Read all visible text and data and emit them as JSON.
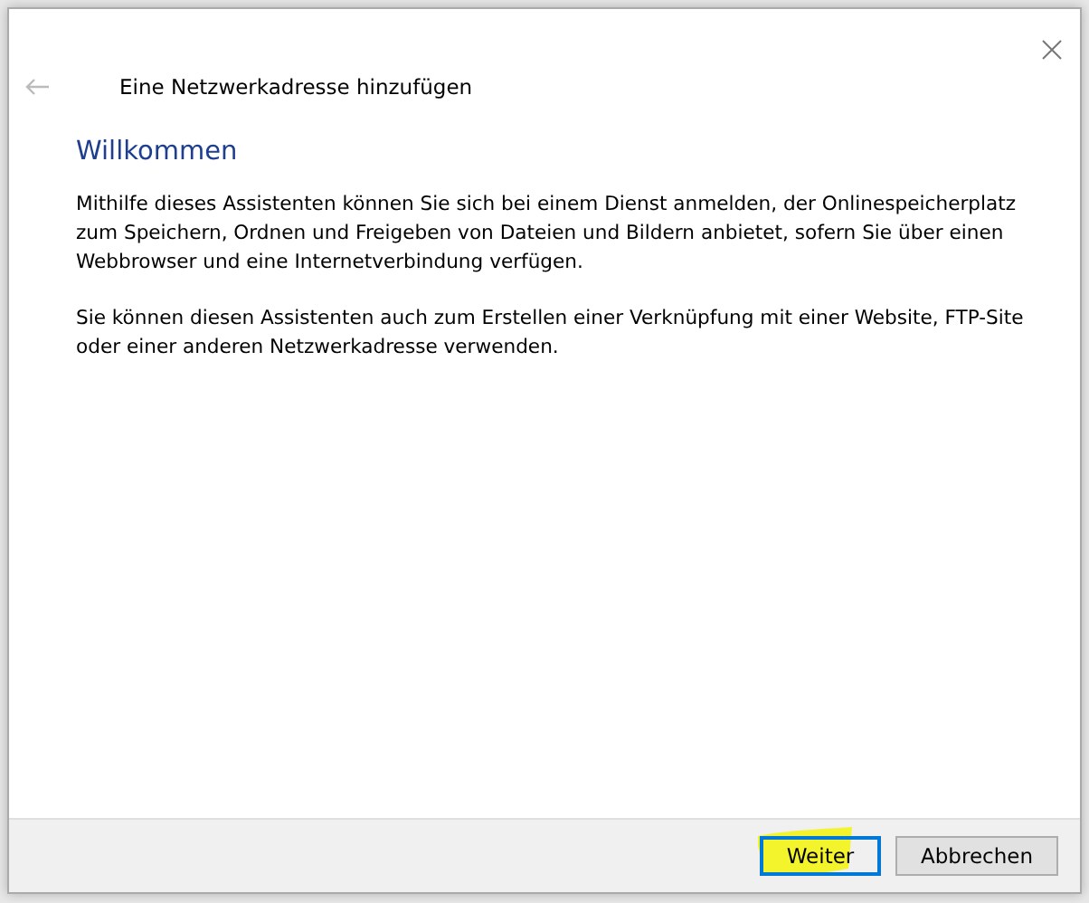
{
  "window": {
    "title": "Eine Netzwerkadresse hinzufügen"
  },
  "heading": "Willkommen",
  "paragraphs": [
    "Mithilfe dieses Assistenten können Sie sich bei einem Dienst anmelden, der Onlinespeicherplatz zum Speichern, Ordnen und Freigeben von Dateien und Bildern anbietet, sofern Sie über einen Webbrowser und eine Internetverbindung verfügen.",
    "Sie können diesen Assistenten auch zum Erstellen einer Verknüpfung mit einer Website, FTP-Site oder einer anderen Netzwerkadresse verwenden."
  ],
  "buttons": [
    {
      "label": "Weiter",
      "selected": true
    },
    {
      "label": "Abbrechen",
      "selected": false
    }
  ]
}
